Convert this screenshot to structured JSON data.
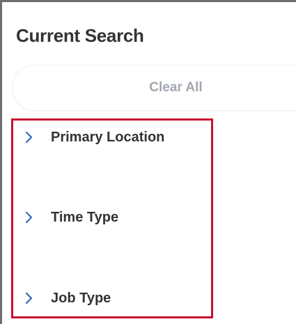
{
  "panel": {
    "title": "Current Search",
    "clear_all_label": "Clear All"
  },
  "facets": [
    {
      "label": "Primary Location",
      "icon": "chevron-right-icon"
    },
    {
      "label": "Time Type",
      "icon": "chevron-right-icon"
    },
    {
      "label": "Job Type",
      "icon": "chevron-right-icon"
    }
  ],
  "colors": {
    "highlight_border": "#c8102e",
    "chevron": "#2e6bb7",
    "clear_all_text": "#a0a7ae",
    "label_text": "#333333"
  }
}
